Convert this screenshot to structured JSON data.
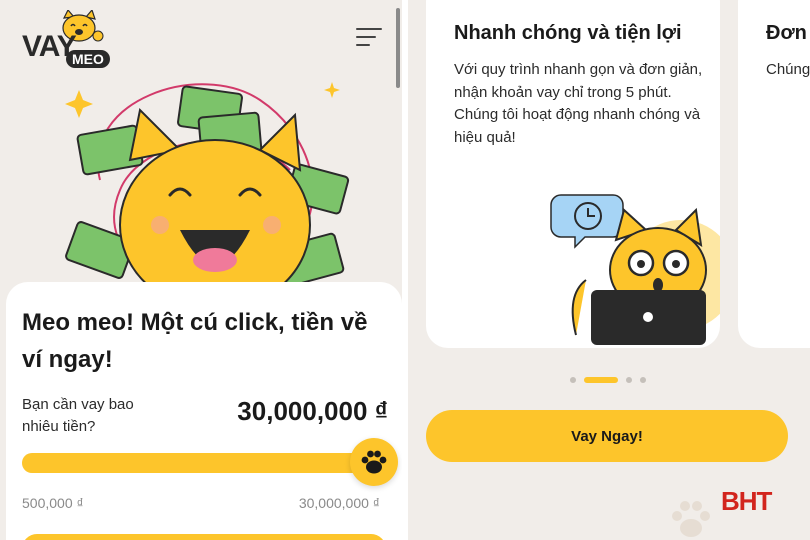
{
  "left_screen": {
    "logo": {
      "word_vay": "VAY",
      "word_meo": "MEO"
    },
    "menu_icon": "hamburger-menu-icon",
    "hero_image": "cat-with-money-illustration",
    "title": "Meo meo! Một cú click, tiền về ví ngay!",
    "amount_label": "Bạn cần vay bao nhiêu tiền?",
    "amount_value": "30,000,000 ₫",
    "slider": {
      "min_label": "500,000 ₫",
      "max_label": "30,000,000 ₫",
      "level": 1.0,
      "thumb_icon": "paw-icon"
    }
  },
  "right_screen": {
    "feature_card": {
      "title": "Nhanh chóng và tiện lợi",
      "description": "Với quy trình nhanh gọn và đơn giản, nhận khoản vay chỉ trong 5 phút. Chúng tôi hoạt động nhanh chóng và hiệu quả!",
      "image": "cat-with-laptop-and-clock-illustration"
    },
    "peek_card": {
      "title": "Đơn",
      "description": "Chúng tối thiể giản đơ vay lý"
    },
    "carousel": {
      "count": 4,
      "active_index": 1
    },
    "cta_label": "Vay Ngay!",
    "watermark": "BHT"
  },
  "colors": {
    "accent": "#fdc52b",
    "background": "#f1ede9",
    "card": "#ffffff",
    "watermark": "#d2251d"
  }
}
